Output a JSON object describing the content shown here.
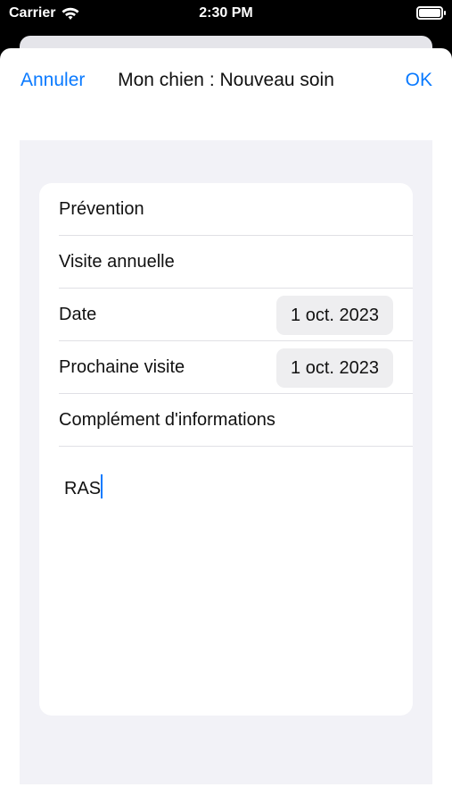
{
  "status": {
    "carrier": "Carrier",
    "time": "2:30 PM"
  },
  "nav": {
    "cancel": "Annuler",
    "title": "Mon chien : Nouveau soin",
    "ok": "OK"
  },
  "form": {
    "type": "Prévention",
    "name": "Visite annuelle",
    "date_label": "Date",
    "date_value": "1 oct. 2023",
    "next_label": "Prochaine visite",
    "next_value": "1 oct. 2023",
    "notes_label": "Complément d'informations",
    "notes_value": "RAS"
  }
}
